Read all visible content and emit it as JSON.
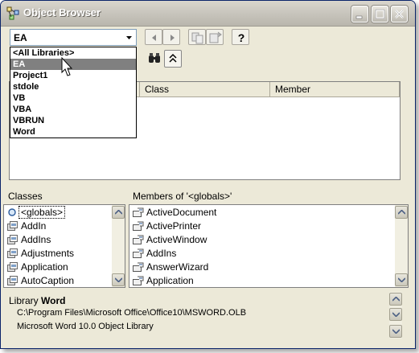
{
  "window": {
    "title": "Object Browser"
  },
  "library_combo": {
    "value": "EA"
  },
  "library_dropdown": {
    "items": [
      "<All Libraries>",
      "EA",
      "Project1",
      "stdole",
      "VB",
      "VBA",
      "VBRUN",
      "Word"
    ],
    "selected": "EA"
  },
  "search_results": {
    "columns": [
      "Class",
      "Member"
    ]
  },
  "classes_panel": {
    "caption": "Classes",
    "items": [
      "<globals>",
      "AddIn",
      "AddIns",
      "Adjustments",
      "Application",
      "AutoCaption"
    ]
  },
  "members_panel": {
    "caption": "Members of '<globals>'",
    "items": [
      "ActiveDocument",
      "ActivePrinter",
      "ActiveWindow",
      "AddIns",
      "AnswerWizard",
      "Application"
    ]
  },
  "details": {
    "prefix": "Library",
    "name": "Word",
    "path": "C:\\Program Files\\Microsoft Office\\Office10\\MSWORD.OLB",
    "description": "Microsoft Word 10.0 Object Library"
  },
  "icons": [
    "object-browser-icon",
    "minimize-icon",
    "maximize-icon",
    "close-icon",
    "dropdown-arrow-icon",
    "back-icon",
    "forward-icon",
    "copy-icon",
    "view-definition-icon",
    "help-icon",
    "binoculars-icon",
    "collapse-icon",
    "globals-icon",
    "class-icon",
    "property-icon",
    "scroll-up-icon",
    "scroll-down-icon",
    "mouse-cursor-icon"
  ],
  "colors": {
    "selection": "#808080",
    "title_text": "#ffffff",
    "window_face": "#ece9d8",
    "border_blue": "#7f9db9"
  }
}
